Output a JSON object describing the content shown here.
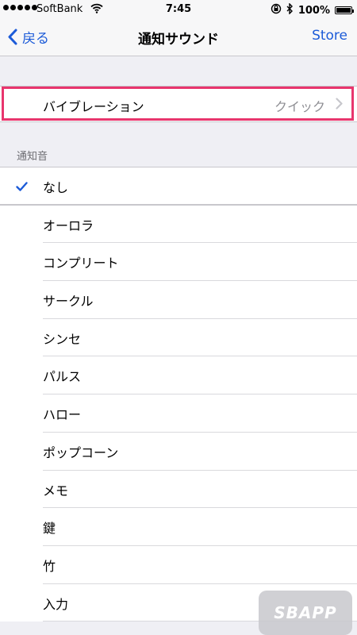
{
  "status_bar": {
    "carrier": "SoftBank",
    "time": "7:45",
    "battery": "100%"
  },
  "nav": {
    "back_label": "戻る",
    "title": "通知サウンド",
    "store_label": "Store"
  },
  "vibration": {
    "label": "バイブレーション",
    "value": "クイック"
  },
  "section": {
    "header": "通知音"
  },
  "tones": [
    {
      "label": "なし",
      "selected": true
    },
    {
      "label": "オーロラ",
      "selected": false
    },
    {
      "label": "コンプリート",
      "selected": false
    },
    {
      "label": "サークル",
      "selected": false
    },
    {
      "label": "シンセ",
      "selected": false
    },
    {
      "label": "パルス",
      "selected": false
    },
    {
      "label": "ハロー",
      "selected": false
    },
    {
      "label": "ポップコーン",
      "selected": false
    },
    {
      "label": "メモ",
      "selected": false
    },
    {
      "label": "鍵",
      "selected": false
    },
    {
      "label": "竹",
      "selected": false
    },
    {
      "label": "入力",
      "selected": false
    }
  ],
  "watermark": "SBAPP",
  "colors": {
    "accent": "#1c5bd8",
    "highlight": "#e8356d"
  }
}
